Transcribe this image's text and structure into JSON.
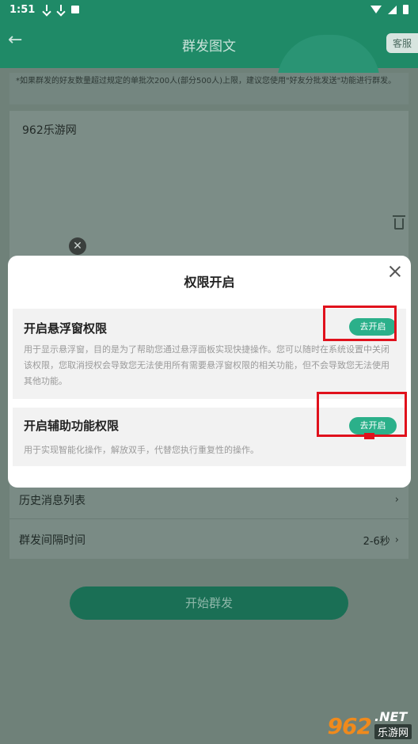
{
  "status_bar": {
    "time": "1:51"
  },
  "header": {
    "title": "群发图文",
    "service": "客服",
    "back_icon": "back-arrow-icon"
  },
  "tip": "*如果群发的好友数量超过规定的单批次200人(部分500人)上限，建议您使用\"好友分批发送\"功能进行群发。",
  "editor": {
    "content": "962乐游网"
  },
  "list": {
    "history": "历史消息列表",
    "interval_label": "群发间隔时间",
    "interval_value": "2-6秒"
  },
  "start_button": "开始群发",
  "dialog": {
    "title": "权限开启",
    "permissions": [
      {
        "title": "开启悬浮窗权限",
        "button": "去开启",
        "description": "用于显示悬浮窗，目的是为了帮助您通过悬浮面板实现快捷操作。您可以随时在系统设置中关闭该权限，您取消授权会导致您无法使用所有需要悬浮窗权限的相关功能，但不会导致您无法使用其他功能。"
      },
      {
        "title": "开启辅助功能权限",
        "button": "去开启",
        "description": "用于实现智能化操作，解放双手，代替您执行重复性的操作。"
      }
    ]
  },
  "watermark": {
    "logo": "962",
    "net": ".NET",
    "text": "乐游网"
  },
  "colors": {
    "accent": "#2bb08a",
    "header": "#1f8a67",
    "annotation": "#e0111c"
  }
}
